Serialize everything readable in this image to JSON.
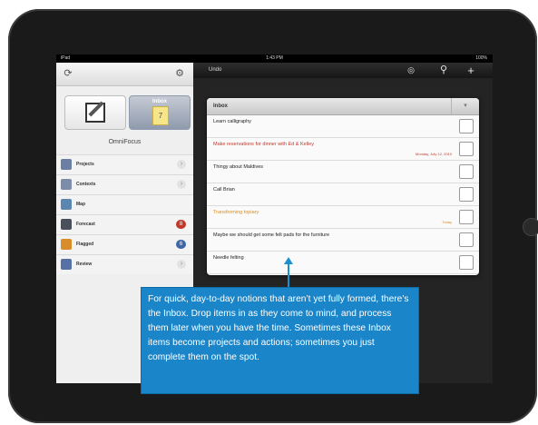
{
  "status_bar": {
    "carrier": "iPad",
    "time": "1:43 PM",
    "battery": "100%"
  },
  "sidebar": {
    "sync_icon": "sync-icon",
    "settings_icon": "gear-icon",
    "inbox_button": {
      "label": "Inbox",
      "count": "7"
    },
    "app_name": "OmniFocus",
    "items": [
      {
        "label": "Projects",
        "accessory": "›",
        "icon_color": "#6b7fa3"
      },
      {
        "label": "Contexts",
        "accessory": "›",
        "icon_color": "#7d8ca8"
      },
      {
        "label": "Map",
        "accessory": "",
        "icon_color": "#5a86b0"
      },
      {
        "label": "Forecast",
        "accessory": "8",
        "badge_color": "#c0392b",
        "icon_color": "#4a4f5c"
      },
      {
        "label": "Flagged",
        "accessory": "6",
        "badge_color": "#3f67a8",
        "icon_color": "#d88d2a"
      },
      {
        "label": "Review",
        "accessory": "›",
        "icon_color": "#5671a5"
      }
    ]
  },
  "toolbar": {
    "undo_label": "Undo",
    "view_icon": "eye-icon",
    "search_icon": "search-icon",
    "add_icon": "plus-icon"
  },
  "inbox_panel": {
    "title": "Inbox",
    "filter_icon": "chevron-down-icon",
    "rows": [
      {
        "text": "Learn calligraphy",
        "date": "",
        "color": "#222222"
      },
      {
        "text": "Make reservations for dinner with Ed & Kelley",
        "date": "Monday, July 12, 2010",
        "color": "#c0392b"
      },
      {
        "text": "Thingy about Maldives",
        "date": "",
        "color": "#222222"
      },
      {
        "text": "Call Brian",
        "date": "",
        "color": "#222222"
      },
      {
        "text": "Transforming topiary",
        "date": "Today",
        "color": "#d98c1e"
      },
      {
        "text": "Maybe we should get some felt pads for the furniture",
        "date": "",
        "color": "#222222"
      },
      {
        "text": "Needle felting",
        "date": "",
        "color": "#222222"
      }
    ]
  },
  "callout": {
    "text": "For quick, day-to-day notions that aren’t yet fully formed, there’s the Inbox. Drop items in as they come to mind, and process them later when you have the time. Sometimes these Inbox items become projects and actions; sometimes you just complete them on the spot."
  }
}
